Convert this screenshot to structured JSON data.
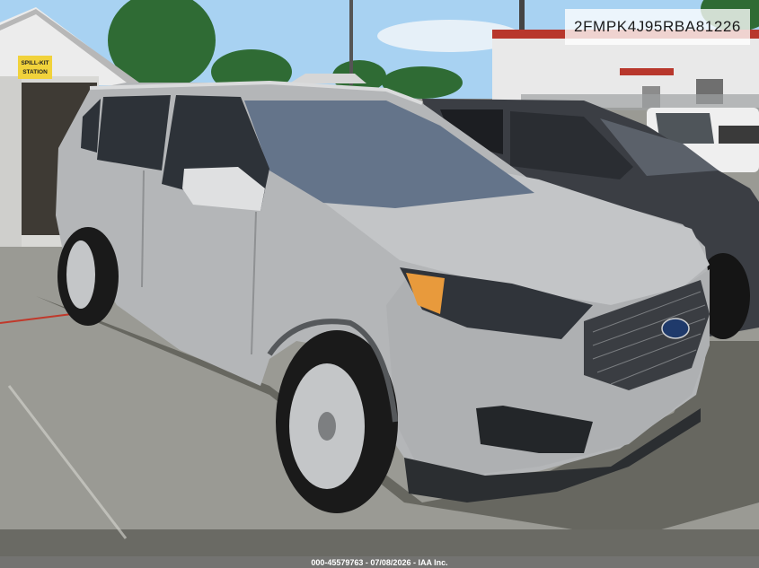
{
  "vin_watermark": "2FMPK4J95RBA81226",
  "footer_caption": "000-45579763 - 07/08/2026 - IAA Inc.",
  "shed_sign": {
    "line1": "SPILL-KIT",
    "line2": "STATION"
  },
  "colors": {
    "sky": "#a8d2f2",
    "vehicle_body": "#b4b6b8",
    "pavement": "#9a9a94",
    "dark_suv": "#3b3e44"
  }
}
